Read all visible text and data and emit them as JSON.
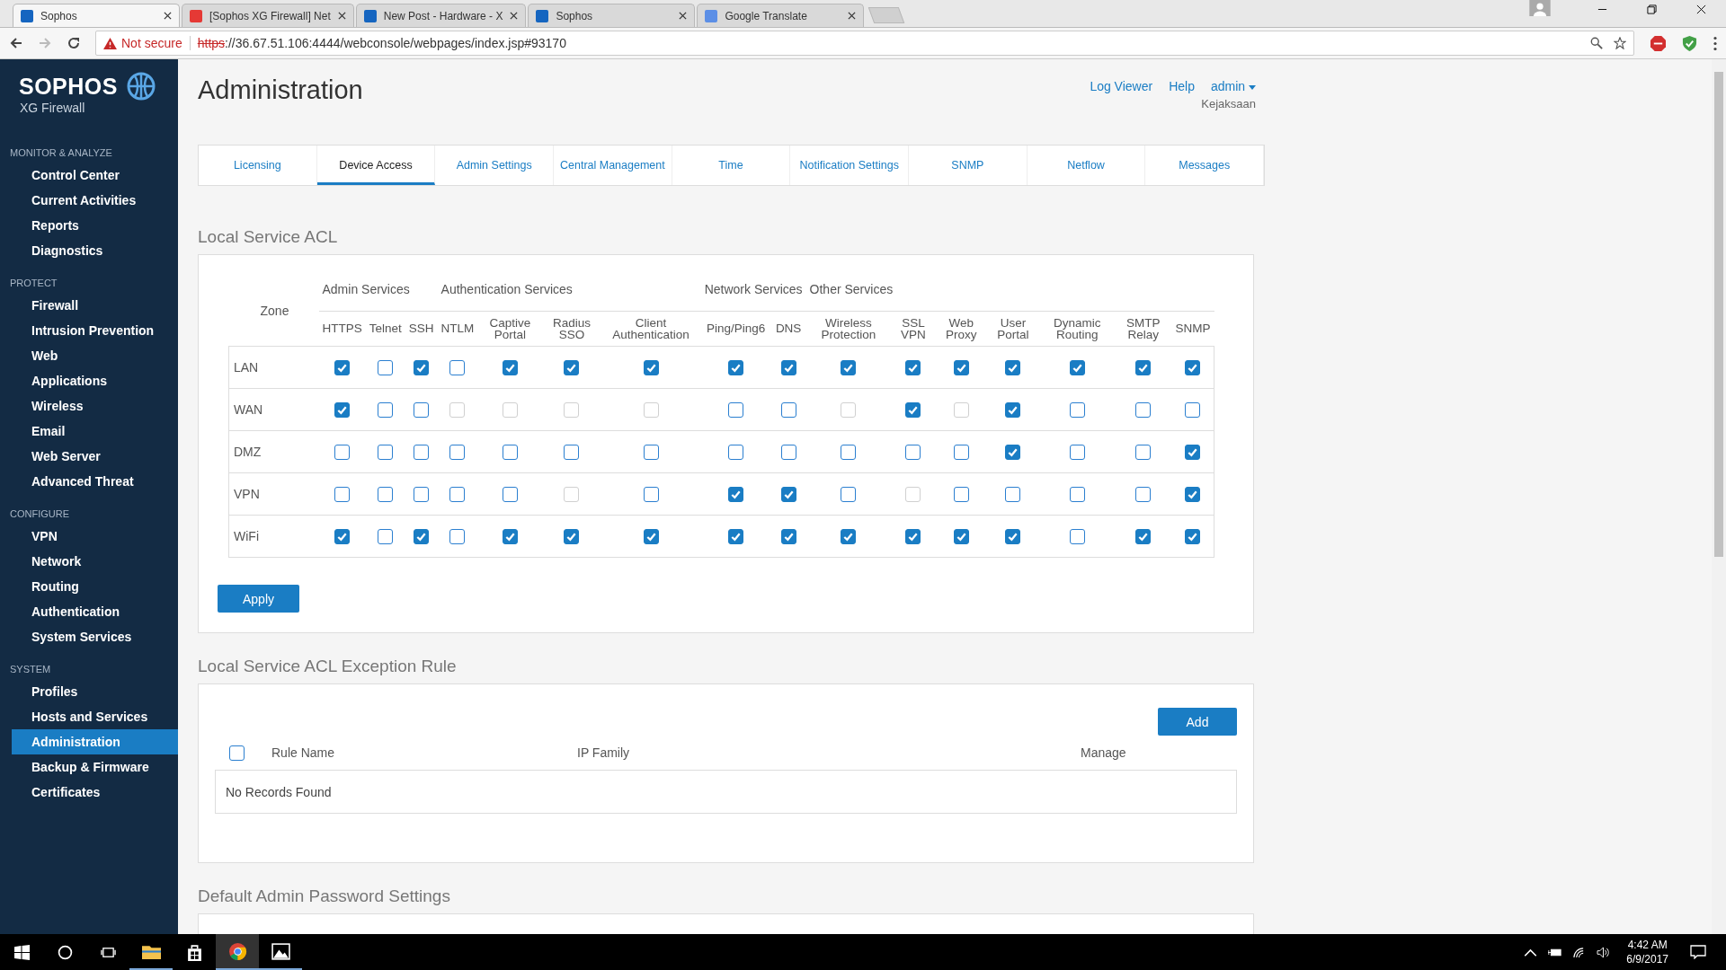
{
  "browser": {
    "tabs": [
      {
        "title": "Sophos",
        "selected": true,
        "kind": "sophos"
      },
      {
        "title": "[Sophos XG Firewall] Net",
        "selected": false,
        "kind": "youtube"
      },
      {
        "title": "New Post - Hardware - X",
        "selected": false,
        "kind": "sophos"
      },
      {
        "title": "Sophos",
        "selected": false,
        "kind": "sophos"
      },
      {
        "title": "Google Translate",
        "selected": false,
        "kind": "translate"
      }
    ],
    "security": "Not secure",
    "url_scheme": "https",
    "url_rest": "://36.67.51.106:4444/webconsole/webpages/index.jsp#93170"
  },
  "sidebar": {
    "brand": "SOPHOS",
    "product": "XG Firewall",
    "sections": [
      {
        "title": "MONITOR & ANALYZE",
        "items": [
          {
            "label": "Control Center",
            "selected": false
          },
          {
            "label": "Current Activities",
            "selected": false
          },
          {
            "label": "Reports",
            "selected": false
          },
          {
            "label": "Diagnostics",
            "selected": false
          }
        ]
      },
      {
        "title": "PROTECT",
        "items": [
          {
            "label": "Firewall",
            "selected": false
          },
          {
            "label": "Intrusion Prevention",
            "selected": false
          },
          {
            "label": "Web",
            "selected": false
          },
          {
            "label": "Applications",
            "selected": false
          },
          {
            "label": "Wireless",
            "selected": false
          },
          {
            "label": "Email",
            "selected": false
          },
          {
            "label": "Web Server",
            "selected": false
          },
          {
            "label": "Advanced Threat",
            "selected": false
          }
        ]
      },
      {
        "title": "CONFIGURE",
        "items": [
          {
            "label": "VPN",
            "selected": false
          },
          {
            "label": "Network",
            "selected": false
          },
          {
            "label": "Routing",
            "selected": false
          },
          {
            "label": "Authentication",
            "selected": false
          },
          {
            "label": "System Services",
            "selected": false
          }
        ]
      },
      {
        "title": "SYSTEM",
        "items": [
          {
            "label": "Profiles",
            "selected": false
          },
          {
            "label": "Hosts and Services",
            "selected": false
          },
          {
            "label": "Administration",
            "selected": true
          },
          {
            "label": "Backup & Firmware",
            "selected": false
          },
          {
            "label": "Certificates",
            "selected": false
          }
        ]
      }
    ]
  },
  "header": {
    "title": "Administration",
    "links": [
      "Log Viewer",
      "Help"
    ],
    "user": "admin",
    "organization": "Kejaksaan"
  },
  "tabs": [
    {
      "label": "Licensing",
      "selected": false
    },
    {
      "label": "Device Access",
      "selected": true
    },
    {
      "label": "Admin Settings",
      "selected": false
    },
    {
      "label": "Central Management",
      "selected": false
    },
    {
      "label": "Time",
      "selected": false
    },
    {
      "label": "Notification Settings",
      "selected": false
    },
    {
      "label": "SNMP",
      "selected": false
    },
    {
      "label": "Netflow",
      "selected": false
    },
    {
      "label": "Messages",
      "selected": false
    }
  ],
  "acl": {
    "title": "Local Service ACL",
    "zone_header": "Zone",
    "groups": [
      {
        "label": "Admin Services"
      },
      {
        "label": "Authentication Services"
      },
      {
        "label": "Network Services"
      },
      {
        "label": "Other Services"
      }
    ],
    "columns": [
      "HTTPS",
      "Telnet",
      "SSH",
      "NTLM",
      "Captive Portal",
      "Radius SSO",
      "Client Authentication",
      "Ping/Ping6",
      "DNS",
      "Wireless Protection",
      "SSL VPN",
      "Web Proxy",
      "User Portal",
      "Dynamic Routing",
      "SMTP Relay",
      "SNMP"
    ],
    "rows": [
      {
        "zone": "LAN",
        "cells": [
          {
            "checked": true,
            "disabled": false
          },
          {
            "checked": false,
            "disabled": false
          },
          {
            "checked": true,
            "disabled": false
          },
          {
            "checked": false,
            "disabled": false
          },
          {
            "checked": true,
            "disabled": false
          },
          {
            "checked": true,
            "disabled": false
          },
          {
            "checked": true,
            "disabled": false
          },
          {
            "checked": true,
            "disabled": false
          },
          {
            "checked": true,
            "disabled": false
          },
          {
            "checked": true,
            "disabled": false
          },
          {
            "checked": true,
            "disabled": false
          },
          {
            "checked": true,
            "disabled": false
          },
          {
            "checked": true,
            "disabled": false
          },
          {
            "checked": true,
            "disabled": false
          },
          {
            "checked": true,
            "disabled": false
          },
          {
            "checked": true,
            "disabled": false
          }
        ]
      },
      {
        "zone": "WAN",
        "cells": [
          {
            "checked": true,
            "disabled": false
          },
          {
            "checked": false,
            "disabled": false
          },
          {
            "checked": false,
            "disabled": false
          },
          {
            "checked": false,
            "disabled": true
          },
          {
            "checked": false,
            "disabled": true
          },
          {
            "checked": false,
            "disabled": true
          },
          {
            "checked": false,
            "disabled": true
          },
          {
            "checked": false,
            "disabled": false
          },
          {
            "checked": false,
            "disabled": false
          },
          {
            "checked": false,
            "disabled": true
          },
          {
            "checked": true,
            "disabled": false
          },
          {
            "checked": false,
            "disabled": true
          },
          {
            "checked": true,
            "disabled": false
          },
          {
            "checked": false,
            "disabled": false
          },
          {
            "checked": false,
            "disabled": false
          },
          {
            "checked": false,
            "disabled": false
          }
        ]
      },
      {
        "zone": "DMZ",
        "cells": [
          {
            "checked": false,
            "disabled": false
          },
          {
            "checked": false,
            "disabled": false
          },
          {
            "checked": false,
            "disabled": false
          },
          {
            "checked": false,
            "disabled": false
          },
          {
            "checked": false,
            "disabled": false
          },
          {
            "checked": false,
            "disabled": false
          },
          {
            "checked": false,
            "disabled": false
          },
          {
            "checked": false,
            "disabled": false
          },
          {
            "checked": false,
            "disabled": false
          },
          {
            "checked": false,
            "disabled": false
          },
          {
            "checked": false,
            "disabled": false
          },
          {
            "checked": false,
            "disabled": false
          },
          {
            "checked": true,
            "disabled": false
          },
          {
            "checked": false,
            "disabled": false
          },
          {
            "checked": false,
            "disabled": false
          },
          {
            "checked": true,
            "disabled": false
          }
        ]
      },
      {
        "zone": "VPN",
        "cells": [
          {
            "checked": false,
            "disabled": false
          },
          {
            "checked": false,
            "disabled": false
          },
          {
            "checked": false,
            "disabled": false
          },
          {
            "checked": false,
            "disabled": false
          },
          {
            "checked": false,
            "disabled": false
          },
          {
            "checked": false,
            "disabled": true
          },
          {
            "checked": false,
            "disabled": false
          },
          {
            "checked": true,
            "disabled": false
          },
          {
            "checked": true,
            "disabled": false
          },
          {
            "checked": false,
            "disabled": false
          },
          {
            "checked": false,
            "disabled": true
          },
          {
            "checked": false,
            "disabled": false
          },
          {
            "checked": false,
            "disabled": false
          },
          {
            "checked": false,
            "disabled": false
          },
          {
            "checked": false,
            "disabled": false
          },
          {
            "checked": true,
            "disabled": false
          }
        ]
      },
      {
        "zone": "WiFi",
        "cells": [
          {
            "checked": true,
            "disabled": false
          },
          {
            "checked": false,
            "disabled": false
          },
          {
            "checked": true,
            "disabled": false
          },
          {
            "checked": false,
            "disabled": false
          },
          {
            "checked": true,
            "disabled": false
          },
          {
            "checked": true,
            "disabled": false
          },
          {
            "checked": true,
            "disabled": false
          },
          {
            "checked": true,
            "disabled": false
          },
          {
            "checked": true,
            "disabled": false
          },
          {
            "checked": true,
            "disabled": false
          },
          {
            "checked": true,
            "disabled": false
          },
          {
            "checked": true,
            "disabled": false
          },
          {
            "checked": true,
            "disabled": false
          },
          {
            "checked": false,
            "disabled": false
          },
          {
            "checked": true,
            "disabled": false
          },
          {
            "checked": true,
            "disabled": false
          }
        ]
      }
    ],
    "apply": "Apply"
  },
  "exceptions": {
    "title": "Local Service ACL Exception Rule",
    "add": "Add",
    "select_all": {
      "checked": false
    },
    "columns": [
      "Rule Name",
      "IP Family",
      "Manage"
    ],
    "empty": "No Records Found"
  },
  "password": {
    "title": "Default Admin Password Settings"
  },
  "taskbar": {
    "time": "4:42 AM",
    "date": "6/9/2017"
  }
}
